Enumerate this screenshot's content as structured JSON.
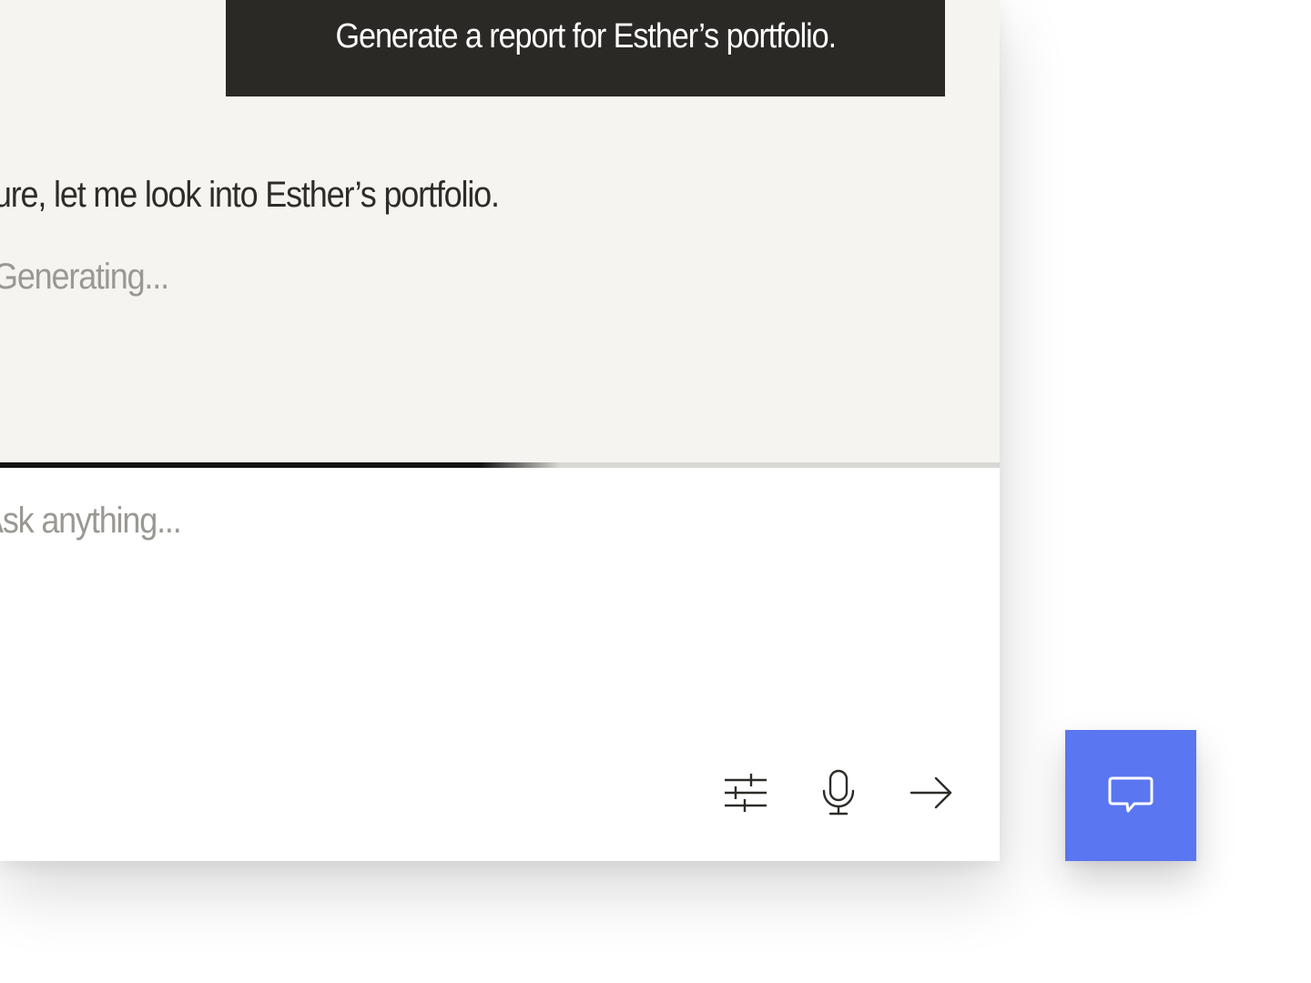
{
  "conversation": {
    "user_message": "Generate a report for Esther’s portfolio.",
    "assistant_message": "Sure, let me look into Esther’s portfolio.",
    "status": "Generating..."
  },
  "progress": {
    "value": 0.56
  },
  "composer": {
    "placeholder": "Ask anything...",
    "value": ""
  },
  "icons": {
    "settings": "sliders-icon",
    "mic": "microphone-icon",
    "send": "arrow-right-icon",
    "chat": "chat-bubble-icon"
  },
  "colors": {
    "panel_background": "#f5f4f1",
    "user_bubble": "#2a2925",
    "fab": "#5a76f0",
    "icon_stroke": "#2d2c28",
    "progress_fill": "#141414"
  }
}
